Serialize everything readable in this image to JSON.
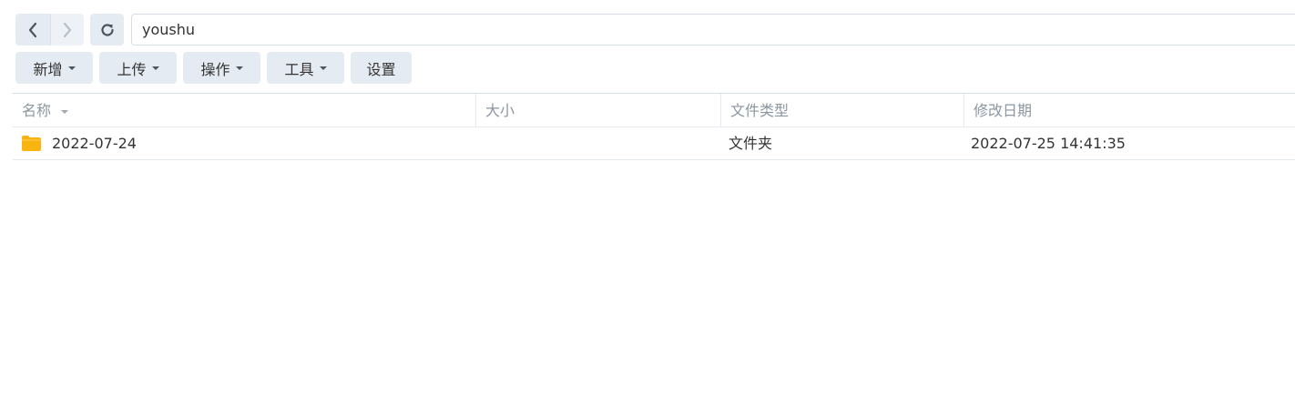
{
  "nav": {
    "back_icon": "chevron-left-icon",
    "forward_icon": "chevron-right-icon",
    "refresh_icon": "refresh-icon",
    "path": "youshu"
  },
  "toolbar": [
    {
      "label": "新增",
      "dropdown": true
    },
    {
      "label": "上传",
      "dropdown": true
    },
    {
      "label": "操作",
      "dropdown": true
    },
    {
      "label": "工具",
      "dropdown": true
    },
    {
      "label": "设置",
      "dropdown": false
    }
  ],
  "table": {
    "columns": [
      "名称",
      "大小",
      "文件类型",
      "修改日期"
    ],
    "sorted_column": "名称",
    "rows": [
      {
        "icon": "folder-icon",
        "name": "2022-07-24",
        "size": "",
        "type": "文件夹",
        "modified": "2022-07-25 14:41:35"
      }
    ]
  },
  "colors": {
    "button_bg": "#e5ebf2",
    "folder": "#f9b40f",
    "header_text": "#8c96a0"
  }
}
